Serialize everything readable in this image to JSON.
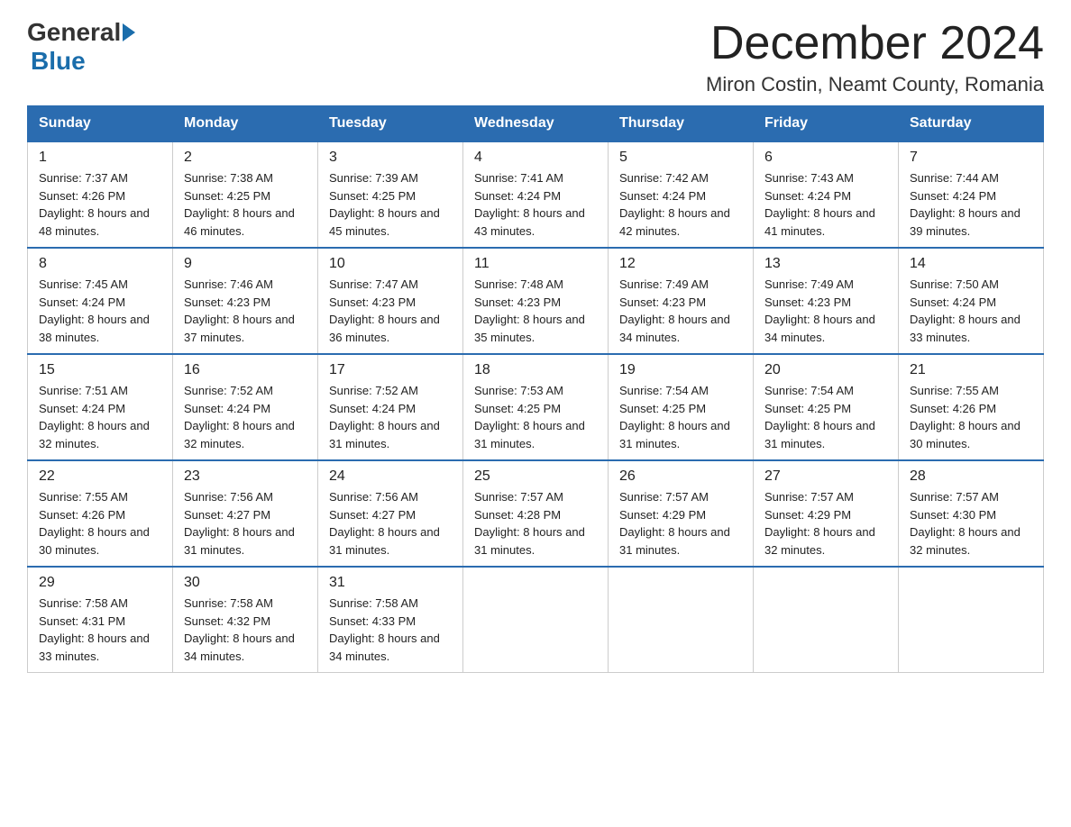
{
  "header": {
    "logo": {
      "general": "General",
      "blue": "Blue",
      "arrow": true
    },
    "month_title": "December 2024",
    "location": "Miron Costin, Neamt County, Romania"
  },
  "weekdays": [
    "Sunday",
    "Monday",
    "Tuesday",
    "Wednesday",
    "Thursday",
    "Friday",
    "Saturday"
  ],
  "weeks": [
    [
      {
        "day": "1",
        "sunrise": "7:37 AM",
        "sunset": "4:26 PM",
        "daylight": "8 hours and 48 minutes."
      },
      {
        "day": "2",
        "sunrise": "7:38 AM",
        "sunset": "4:25 PM",
        "daylight": "8 hours and 46 minutes."
      },
      {
        "day": "3",
        "sunrise": "7:39 AM",
        "sunset": "4:25 PM",
        "daylight": "8 hours and 45 minutes."
      },
      {
        "day": "4",
        "sunrise": "7:41 AM",
        "sunset": "4:24 PM",
        "daylight": "8 hours and 43 minutes."
      },
      {
        "day": "5",
        "sunrise": "7:42 AM",
        "sunset": "4:24 PM",
        "daylight": "8 hours and 42 minutes."
      },
      {
        "day": "6",
        "sunrise": "7:43 AM",
        "sunset": "4:24 PM",
        "daylight": "8 hours and 41 minutes."
      },
      {
        "day": "7",
        "sunrise": "7:44 AM",
        "sunset": "4:24 PM",
        "daylight": "8 hours and 39 minutes."
      }
    ],
    [
      {
        "day": "8",
        "sunrise": "7:45 AM",
        "sunset": "4:24 PM",
        "daylight": "8 hours and 38 minutes."
      },
      {
        "day": "9",
        "sunrise": "7:46 AM",
        "sunset": "4:23 PM",
        "daylight": "8 hours and 37 minutes."
      },
      {
        "day": "10",
        "sunrise": "7:47 AM",
        "sunset": "4:23 PM",
        "daylight": "8 hours and 36 minutes."
      },
      {
        "day": "11",
        "sunrise": "7:48 AM",
        "sunset": "4:23 PM",
        "daylight": "8 hours and 35 minutes."
      },
      {
        "day": "12",
        "sunrise": "7:49 AM",
        "sunset": "4:23 PM",
        "daylight": "8 hours and 34 minutes."
      },
      {
        "day": "13",
        "sunrise": "7:49 AM",
        "sunset": "4:23 PM",
        "daylight": "8 hours and 34 minutes."
      },
      {
        "day": "14",
        "sunrise": "7:50 AM",
        "sunset": "4:24 PM",
        "daylight": "8 hours and 33 minutes."
      }
    ],
    [
      {
        "day": "15",
        "sunrise": "7:51 AM",
        "sunset": "4:24 PM",
        "daylight": "8 hours and 32 minutes."
      },
      {
        "day": "16",
        "sunrise": "7:52 AM",
        "sunset": "4:24 PM",
        "daylight": "8 hours and 32 minutes."
      },
      {
        "day": "17",
        "sunrise": "7:52 AM",
        "sunset": "4:24 PM",
        "daylight": "8 hours and 31 minutes."
      },
      {
        "day": "18",
        "sunrise": "7:53 AM",
        "sunset": "4:25 PM",
        "daylight": "8 hours and 31 minutes."
      },
      {
        "day": "19",
        "sunrise": "7:54 AM",
        "sunset": "4:25 PM",
        "daylight": "8 hours and 31 minutes."
      },
      {
        "day": "20",
        "sunrise": "7:54 AM",
        "sunset": "4:25 PM",
        "daylight": "8 hours and 31 minutes."
      },
      {
        "day": "21",
        "sunrise": "7:55 AM",
        "sunset": "4:26 PM",
        "daylight": "8 hours and 30 minutes."
      }
    ],
    [
      {
        "day": "22",
        "sunrise": "7:55 AM",
        "sunset": "4:26 PM",
        "daylight": "8 hours and 30 minutes."
      },
      {
        "day": "23",
        "sunrise": "7:56 AM",
        "sunset": "4:27 PM",
        "daylight": "8 hours and 31 minutes."
      },
      {
        "day": "24",
        "sunrise": "7:56 AM",
        "sunset": "4:27 PM",
        "daylight": "8 hours and 31 minutes."
      },
      {
        "day": "25",
        "sunrise": "7:57 AM",
        "sunset": "4:28 PM",
        "daylight": "8 hours and 31 minutes."
      },
      {
        "day": "26",
        "sunrise": "7:57 AM",
        "sunset": "4:29 PM",
        "daylight": "8 hours and 31 minutes."
      },
      {
        "day": "27",
        "sunrise": "7:57 AM",
        "sunset": "4:29 PM",
        "daylight": "8 hours and 32 minutes."
      },
      {
        "day": "28",
        "sunrise": "7:57 AM",
        "sunset": "4:30 PM",
        "daylight": "8 hours and 32 minutes."
      }
    ],
    [
      {
        "day": "29",
        "sunrise": "7:58 AM",
        "sunset": "4:31 PM",
        "daylight": "8 hours and 33 minutes."
      },
      {
        "day": "30",
        "sunrise": "7:58 AM",
        "sunset": "4:32 PM",
        "daylight": "8 hours and 34 minutes."
      },
      {
        "day": "31",
        "sunrise": "7:58 AM",
        "sunset": "4:33 PM",
        "daylight": "8 hours and 34 minutes."
      },
      null,
      null,
      null,
      null
    ]
  ],
  "labels": {
    "sunrise_prefix": "Sunrise: ",
    "sunset_prefix": "Sunset: ",
    "daylight_prefix": "Daylight: "
  }
}
